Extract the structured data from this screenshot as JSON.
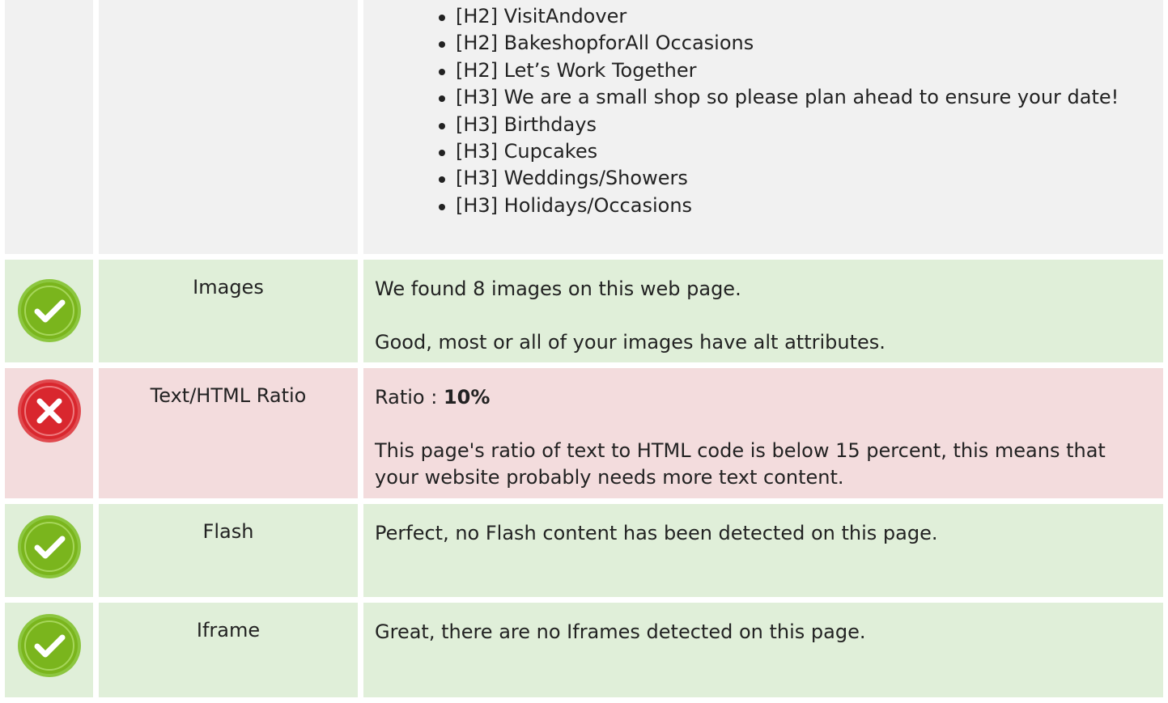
{
  "headings": {
    "items": [
      "[H2] VisitAndover",
      "[H2] BakeshopforAll Occasions",
      "[H2] Let’s Work Together",
      "[H3] We are a small shop so please plan ahead to ensure your date!",
      "[H3] Birthdays",
      "[H3] Cupcakes",
      "[H3] Weddings/Showers",
      "[H3] Holidays/Occasions"
    ]
  },
  "rows": {
    "images": {
      "status": "pass",
      "status_icon": "check-circle-icon",
      "label": "Images",
      "line1": "We found 8 images on this web page.",
      "line2": "Good, most or all of your images have alt attributes."
    },
    "ratio": {
      "status": "fail",
      "status_icon": "cross-circle-icon",
      "label": "Text/HTML Ratio",
      "prefix": "Ratio : ",
      "value": "10%",
      "line2": "This page's ratio of text to HTML code is below 15 percent, this means that your website probably needs more text content."
    },
    "flash": {
      "status": "pass",
      "status_icon": "check-circle-icon",
      "label": "Flash",
      "line1": "Perfect, no Flash content has been detected on this page."
    },
    "iframe": {
      "status": "pass",
      "status_icon": "check-circle-icon",
      "label": "Iframe",
      "line1": "Great, there are no Iframes detected on this page."
    }
  },
  "colors": {
    "pass_bg": "#e0efd9",
    "fail_bg": "#f3dcdd",
    "neutral_bg": "#f1f1f1",
    "pass_icon": "#7ab51d",
    "fail_icon": "#d9272e"
  }
}
